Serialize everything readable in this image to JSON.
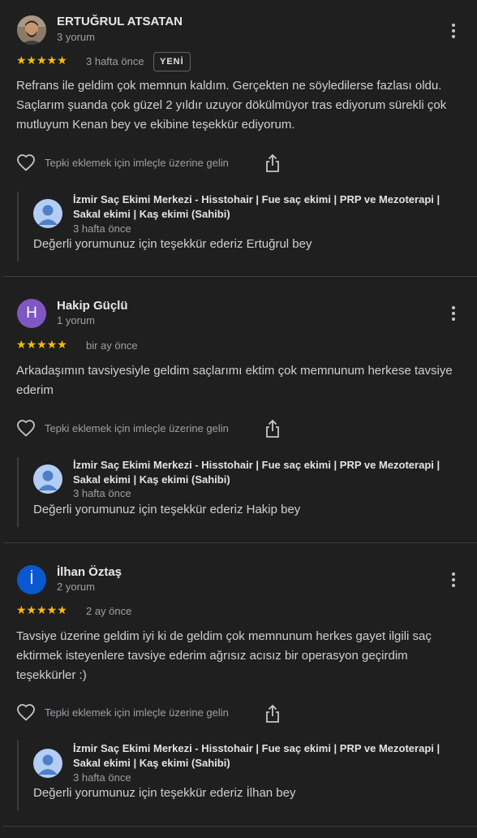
{
  "colors": {
    "background": "#1f1f1f",
    "star": "#fbbc04",
    "avatar_hakip": "#7e57c2",
    "avatar_ilhan": "#0b57d0"
  },
  "reviews": [
    {
      "name": "ERTUĞRUL ATSATAN",
      "count": "3 yorum",
      "stars": "★★★★★",
      "rating": 5,
      "when": "3 hafta önce",
      "badge": "YENİ",
      "text": "Refrans ile geldim çok memnun kaldım. Gerçekten ne söyledilerse fazlası oldu. Saçlarım şuanda çok güzel 2 yıldır uzuyor dökülmüyor tras ediyorum sürekli çok mutluyum Kenan bey ve ekibine teşekkür ediyorum.",
      "reaction_hint": "Tepki eklemek için imleçle üzerine gelin",
      "owner_name": "İzmir Saç Ekimi Merkezi - Hisstohair | Fue saç ekimi | PRP ve Mezoterapi | Sakal ekimi | Kaş ekimi (Sahibi)",
      "owner_when": "3 hafta önce",
      "owner_text": "Değerli yorumunuz için teşekkür ederiz Ertuğrul bey"
    },
    {
      "name": "Hakip Güçlü",
      "initial": "H",
      "count": "1 yorum",
      "stars": "★★★★★",
      "rating": 5,
      "when": "bir ay önce",
      "text": "Arkadaşımın tavsiyesiyle geldim saçlarımı ektim çok memnunum herkese tavsiye ederim",
      "reaction_hint": "Tepki eklemek için imleçle üzerine gelin",
      "owner_name": "İzmir Saç Ekimi Merkezi - Hisstohair | Fue saç ekimi | PRP ve Mezoterapi | Sakal ekimi | Kaş ekimi (Sahibi)",
      "owner_when": "3 hafta önce",
      "owner_text": "Değerli yorumunuz için teşekkür ederiz Hakip bey"
    },
    {
      "name": "İlhan Öztaş",
      "initial": "İ",
      "count": "2 yorum",
      "stars": "★★★★★",
      "rating": 5,
      "when": "2 ay önce",
      "text": "Tavsiye üzerine geldim iyi ki de geldim çok memnunum herkes gayet ilgili saç ektirmek isteyenlere tavsiye ederim ağrısız acısız bir operasyon geçirdim teşekkürler :)",
      "reaction_hint": "Tepki eklemek için imleçle üzerine gelin",
      "owner_name": "İzmir Saç Ekimi Merkezi - Hisstohair | Fue saç ekimi | PRP ve Mezoterapi | Sakal ekimi | Kaş ekimi (Sahibi)",
      "owner_when": "3 hafta önce",
      "owner_text": "Değerli yorumunuz için teşekkür ederiz İlhan bey"
    }
  ]
}
